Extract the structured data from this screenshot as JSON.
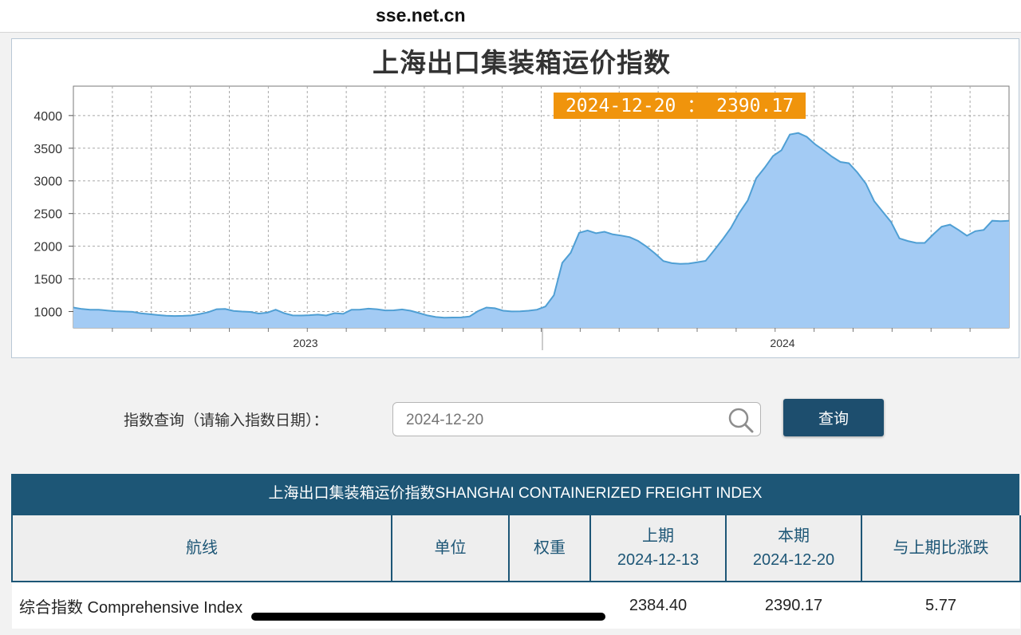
{
  "browser": {
    "url": "sse.net.cn"
  },
  "chart_data": {
    "type": "area",
    "title": "上海出口集装箱运价指数",
    "x_labels": [
      "2023",
      "2024"
    ],
    "y_ticks": [
      1000,
      1500,
      2000,
      2500,
      3000,
      3500,
      4000
    ],
    "ylim": [
      750,
      4450
    ],
    "grid": true,
    "tooltip": "2024-12-20 ： 2390.17",
    "colors": {
      "fill": "#a3cbf4",
      "line": "#4f9fd4",
      "tooltip": "#f0940c"
    },
    "series": [
      {
        "values": [
          1061,
          1039,
          1029,
          1029,
          1016,
          1005,
          1000,
          995,
          973,
          961,
          946,
          936,
          932,
          935,
          940,
          962,
          991,
          1036,
          1040,
          1010,
          1000,
          994,
          970,
          983,
          1029,
          975,
          940,
          939,
          944,
          953,
          939,
          976,
          965,
          1029,
          1030,
          1044,
          1036,
          1017,
          1019,
          1032,
          1013,
          977,
          941,
          916,
          905,
          909,
          910,
          925,
          1006,
          1061,
          1050,
          1013,
          1002,
          1004,
          1013,
          1029,
          1077,
          1250,
          1745,
          1900,
          2206,
          2241,
          2200,
          2221,
          2181,
          2163,
          2139,
          2081,
          1993,
          1889,
          1773,
          1740,
          1731,
          1734,
          1754,
          1776,
          1935,
          2100,
          2280,
          2510,
          2700,
          3040,
          3200,
          3380,
          3470,
          3710,
          3733,
          3675,
          3560,
          3470,
          3370,
          3290,
          3270,
          3130,
          2960,
          2690,
          2530,
          2370,
          2120,
          2080,
          2050,
          2050,
          2180,
          2300,
          2330,
          2250,
          2160,
          2230,
          2250,
          2390,
          2384,
          2390
        ]
      }
    ]
  },
  "query": {
    "label": "指数查询（请输入指数日期）：",
    "placeholder": "2024-12-20",
    "button": "查询"
  },
  "table": {
    "title": "上海出口集装箱运价指数SHANGHAI CONTAINERIZED FREIGHT INDEX",
    "headers": {
      "route": "航线",
      "unit": "单位",
      "weight": "权重",
      "prev_label": "上期",
      "prev_date": "2024-12-13",
      "curr_label": "本期",
      "curr_date": "2024-12-20",
      "change": "与上期比涨跌"
    },
    "rows": [
      {
        "route": "综合指数 Comprehensive Index",
        "unit": "",
        "weight": "",
        "prev": "2384.40",
        "curr": "2390.17",
        "change": "5.77"
      }
    ]
  }
}
